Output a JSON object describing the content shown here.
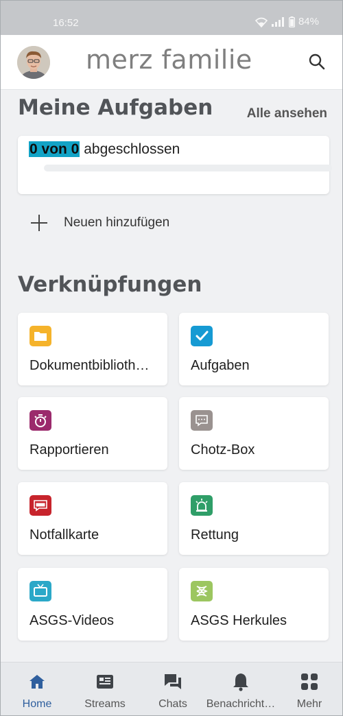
{
  "status_bar": {
    "time": "16:52",
    "battery": "84%"
  },
  "header": {
    "title": "merz familie"
  },
  "tasks": {
    "section_title": "Meine Aufgaben",
    "see_all_label": "Alle ansehen",
    "count_text": "0 von 0",
    "completed_text": "abgeschlossen",
    "progress": 0,
    "add_new_label": "Neuen hinzufügen"
  },
  "shortcuts": {
    "section_title": "Verknüpfungen",
    "items": [
      {
        "label": "Dokumentbiblioth…",
        "icon": "folder-icon",
        "color": "#f5b32b"
      },
      {
        "label": "Aufgaben",
        "icon": "checkbox-icon",
        "color": "#169ad3"
      },
      {
        "label": "Rapportieren",
        "icon": "stopwatch-icon",
        "color": "#9b2a6c"
      },
      {
        "label": "Chotz-Box",
        "icon": "chat-box-icon",
        "color": "#9a9290"
      },
      {
        "label": "Notfallkarte",
        "icon": "sos-icon",
        "color": "#c7242c"
      },
      {
        "label": "Rettung",
        "icon": "siren-icon",
        "color": "#2f9e68"
      },
      {
        "label": "ASGS-Videos",
        "icon": "tv-icon",
        "color": "#2ba8c8"
      },
      {
        "label": "ASGS Herkules",
        "icon": "herkules-icon",
        "color": "#9cc660"
      }
    ]
  },
  "bottom_nav": {
    "active_color": "#2f5f9e",
    "items": [
      {
        "label": "Home",
        "icon": "home-icon"
      },
      {
        "label": "Streams",
        "icon": "streams-icon"
      },
      {
        "label": "Chats",
        "icon": "chats-icon"
      },
      {
        "label": "Benachricht…",
        "icon": "bell-icon"
      },
      {
        "label": "Mehr",
        "icon": "more-grid-icon"
      }
    ]
  }
}
